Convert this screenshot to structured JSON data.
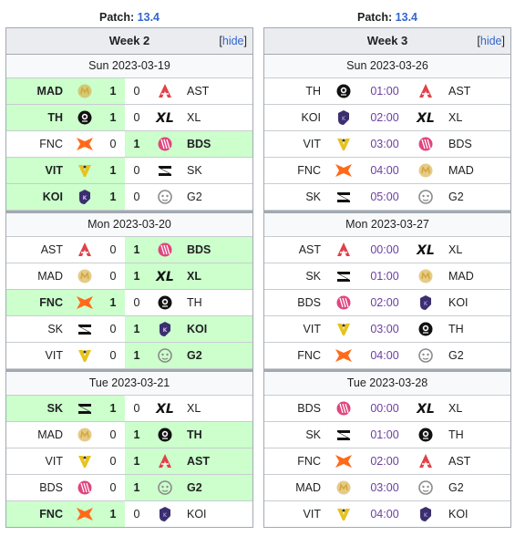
{
  "left": {
    "patch_label": "Patch:",
    "patch_value": "13.4",
    "week_title": "Week 2",
    "hide_open": "[",
    "hide_label": "hide",
    "hide_close": "]",
    "days": [
      {
        "date": "Sun 2023-03-19",
        "matches": [
          {
            "team1": "MAD",
            "logo1": "MAD",
            "score1": "1",
            "score2": "0",
            "team2": "AST",
            "logo2": "AST",
            "winner": 1
          },
          {
            "team1": "TH",
            "logo1": "TH",
            "score1": "1",
            "score2": "0",
            "team2": "XL",
            "logo2": "XL",
            "winner": 1
          },
          {
            "team1": "FNC",
            "logo1": "FNC",
            "score1": "0",
            "score2": "1",
            "team2": "BDS",
            "logo2": "BDS",
            "winner": 2
          },
          {
            "team1": "VIT",
            "logo1": "VIT",
            "score1": "1",
            "score2": "0",
            "team2": "SK",
            "logo2": "SK",
            "winner": 1
          },
          {
            "team1": "KOI",
            "logo1": "KOI",
            "score1": "1",
            "score2": "0",
            "team2": "G2",
            "logo2": "G2",
            "winner": 1
          }
        ]
      },
      {
        "date": "Mon 2023-03-20",
        "matches": [
          {
            "team1": "AST",
            "logo1": "AST",
            "score1": "0",
            "score2": "1",
            "team2": "BDS",
            "logo2": "BDS",
            "winner": 2
          },
          {
            "team1": "MAD",
            "logo1": "MAD",
            "score1": "0",
            "score2": "1",
            "team2": "XL",
            "logo2": "XL",
            "winner": 2
          },
          {
            "team1": "FNC",
            "logo1": "FNC",
            "score1": "1",
            "score2": "0",
            "team2": "TH",
            "logo2": "TH",
            "winner": 1
          },
          {
            "team1": "SK",
            "logo1": "SK",
            "score1": "0",
            "score2": "1",
            "team2": "KOI",
            "logo2": "KOI",
            "winner": 2
          },
          {
            "team1": "VIT",
            "logo1": "VIT",
            "score1": "0",
            "score2": "1",
            "team2": "G2",
            "logo2": "G2",
            "winner": 2
          }
        ]
      },
      {
        "date": "Tue 2023-03-21",
        "matches": [
          {
            "team1": "SK",
            "logo1": "SK",
            "score1": "1",
            "score2": "0",
            "team2": "XL",
            "logo2": "XL",
            "winner": 1
          },
          {
            "team1": "MAD",
            "logo1": "MAD",
            "score1": "0",
            "score2": "1",
            "team2": "TH",
            "logo2": "TH",
            "winner": 2
          },
          {
            "team1": "VIT",
            "logo1": "VIT",
            "score1": "0",
            "score2": "1",
            "team2": "AST",
            "logo2": "AST",
            "winner": 2
          },
          {
            "team1": "BDS",
            "logo1": "BDS",
            "score1": "0",
            "score2": "1",
            "team2": "G2",
            "logo2": "G2",
            "winner": 2
          },
          {
            "team1": "FNC",
            "logo1": "FNC",
            "score1": "1",
            "score2": "0",
            "team2": "KOI",
            "logo2": "KOI",
            "winner": 1
          }
        ]
      }
    ]
  },
  "right": {
    "patch_label": "Patch:",
    "patch_value": "13.4",
    "week_title": "Week 3",
    "hide_open": "[",
    "hide_label": "hide",
    "hide_close": "]",
    "days": [
      {
        "date": "Sun 2023-03-26",
        "matches": [
          {
            "team1": "TH",
            "logo1": "TH",
            "time": "01:00",
            "team2": "AST",
            "logo2": "AST"
          },
          {
            "team1": "KOI",
            "logo1": "KOI",
            "time": "02:00",
            "team2": "XL",
            "logo2": "XL"
          },
          {
            "team1": "VIT",
            "logo1": "VIT",
            "time": "03:00",
            "team2": "BDS",
            "logo2": "BDS"
          },
          {
            "team1": "FNC",
            "logo1": "FNC",
            "time": "04:00",
            "team2": "MAD",
            "logo2": "MAD"
          },
          {
            "team1": "SK",
            "logo1": "SK",
            "time": "05:00",
            "team2": "G2",
            "logo2": "G2"
          }
        ]
      },
      {
        "date": "Mon 2023-03-27",
        "matches": [
          {
            "team1": "AST",
            "logo1": "AST",
            "time": "00:00",
            "team2": "XL",
            "logo2": "XL"
          },
          {
            "team1": "SK",
            "logo1": "SK",
            "time": "01:00",
            "team2": "MAD",
            "logo2": "MAD"
          },
          {
            "team1": "BDS",
            "logo1": "BDS",
            "time": "02:00",
            "team2": "KOI",
            "logo2": "KOI"
          },
          {
            "team1": "VIT",
            "logo1": "VIT",
            "time": "03:00",
            "team2": "TH",
            "logo2": "TH"
          },
          {
            "team1": "FNC",
            "logo1": "FNC",
            "time": "04:00",
            "team2": "G2",
            "logo2": "G2"
          }
        ]
      },
      {
        "date": "Tue 2023-03-28",
        "matches": [
          {
            "team1": "BDS",
            "logo1": "BDS",
            "time": "00:00",
            "team2": "XL",
            "logo2": "XL"
          },
          {
            "team1": "SK",
            "logo1": "SK",
            "time": "01:00",
            "team2": "TH",
            "logo2": "TH"
          },
          {
            "team1": "FNC",
            "logo1": "FNC",
            "time": "02:00",
            "team2": "AST",
            "logo2": "AST"
          },
          {
            "team1": "MAD",
            "logo1": "MAD",
            "time": "03:00",
            "team2": "G2",
            "logo2": "G2"
          },
          {
            "team1": "VIT",
            "logo1": "VIT",
            "time": "04:00",
            "team2": "KOI",
            "logo2": "KOI"
          }
        ]
      }
    ]
  },
  "colors": {
    "win_bg": "#ccffcc",
    "link": "#3366cc",
    "time": "#6b3fa0",
    "AST": "#e2404a",
    "BDS": "#e0467f",
    "FNC": "#ff6a1a",
    "VIT": "#e8c21e",
    "MAD": "#d4a83a",
    "KOI": "#3b2f6e",
    "G2": "#8a8a8a",
    "SK": "#111111",
    "TH": "#111111",
    "XL": "#111111"
  }
}
